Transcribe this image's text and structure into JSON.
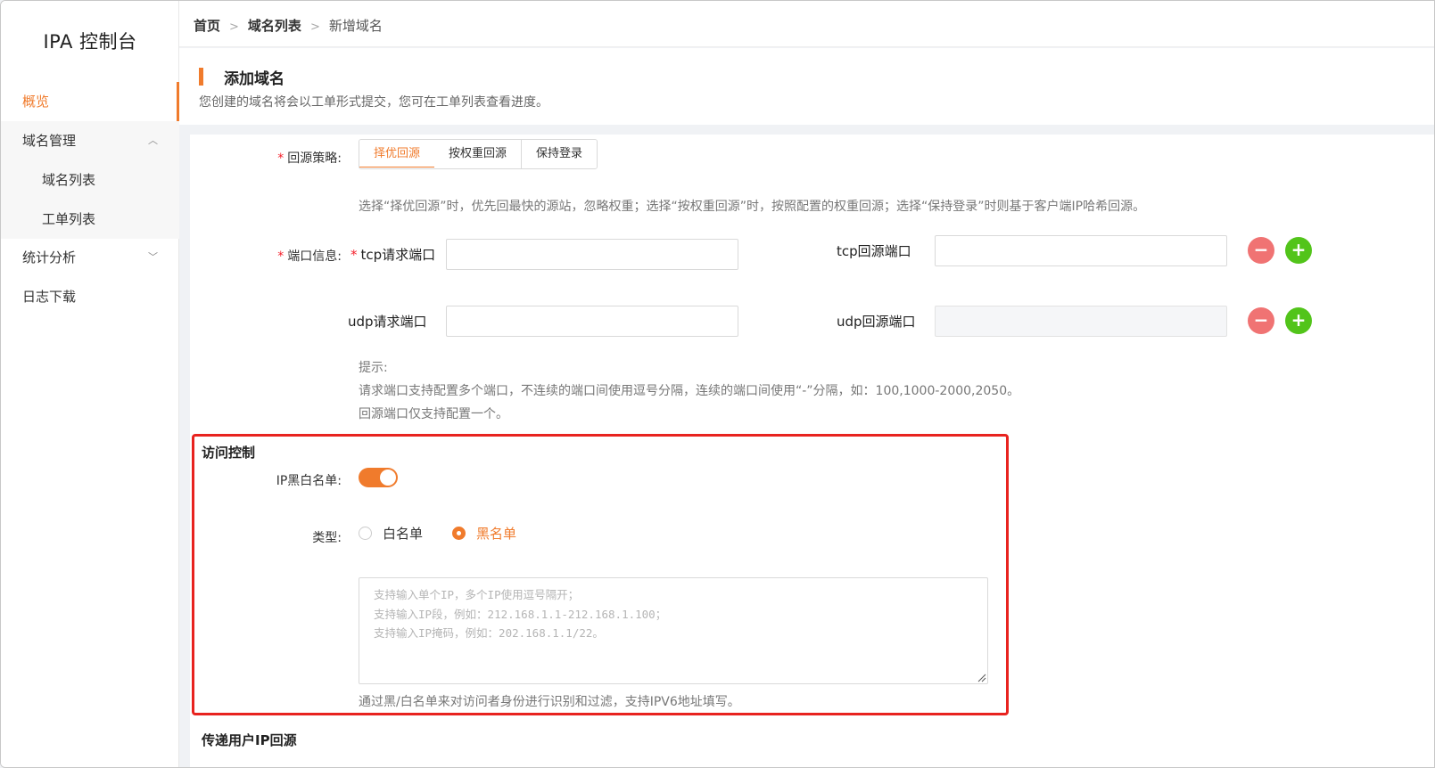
{
  "sidebar": {
    "logo": "IPA 控制台",
    "items": [
      {
        "label": "概览",
        "active": true
      },
      {
        "label": "域名管理",
        "expanded": true
      },
      {
        "label": "域名列表",
        "sub": true
      },
      {
        "label": "工单列表",
        "sub": true
      },
      {
        "label": "统计分析",
        "expanded": false
      },
      {
        "label": "日志下载"
      }
    ]
  },
  "breadcrumb": [
    "首页",
    "域名列表",
    "新增域名"
  ],
  "header": {
    "title": "添加域名",
    "desc": "您创建的域名将会以工单形式提交，您可在工单列表查看进度。"
  },
  "strategy": {
    "label": "回源策略:",
    "options": [
      "择优回源",
      "按权重回源",
      "保持登录"
    ],
    "selected": 0,
    "hint": "选择“择优回源”时，优先回最快的源站，忽略权重；选择“按权重回源”时，按照配置的权重回源；选择“保持登录”时则基于客户端IP哈希回源。"
  },
  "ports": {
    "label": "端口信息:",
    "tcp_request": "tcp请求端口",
    "tcp_origin": "tcp回源端口",
    "udp_request": "udp请求端口",
    "udp_origin": "udp回源端口",
    "minus": "−",
    "plus": "+",
    "hint_title": "提示:",
    "hint_line1": "请求端口支持配置多个端口，不连续的端口间使用逗号分隔，连续的端口间使用“-”分隔，如：100,1000-2000,2050。",
    "hint_line2": "回源端口仅支持配置一个。"
  },
  "access": {
    "section_title": "访问控制",
    "ip_list_label": "IP黑白名单:",
    "ip_list_enabled": true,
    "type_label": "类型:",
    "type_options": [
      "白名单",
      "黑名单"
    ],
    "type_selected": 1,
    "textarea_placeholder": "支持输入单个IP，多个IP使用逗号隔开；\n支持输入IP段，例如：212.168.1.1-212.168.1.100；\n支持输入IP掩码，例如：202.168.1.1/22。",
    "hint": "通过黑/白名单来对访问者身份进行识别和过滤，支持IPV6地址填写。"
  },
  "next_section": "传递用户IP回源",
  "colors": {
    "accent": "#f07b2c",
    "danger": "#f07373",
    "success": "#52c41a",
    "highlight": "#e8231f"
  }
}
